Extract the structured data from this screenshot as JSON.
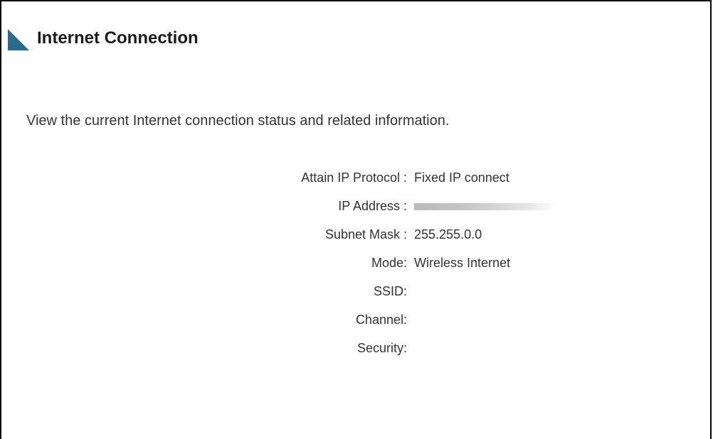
{
  "header": {
    "title": "Internet Connection",
    "accent_color": "#2b6a8f",
    "marker_icon": "triangle-corner-icon"
  },
  "intro": "View the current Internet connection status and related information.",
  "fields": [
    {
      "label": "Attain IP Protocol :",
      "value": "Fixed IP connect"
    },
    {
      "label": "IP Address :",
      "value": ""
    },
    {
      "label": "Subnet Mask :",
      "value": "255.255.0.0"
    },
    {
      "label": "Mode:",
      "value": "Wireless Internet"
    },
    {
      "label": "SSID:",
      "value": ""
    },
    {
      "label": "Channel:",
      "value": ""
    },
    {
      "label": "Security:",
      "value": ""
    }
  ]
}
